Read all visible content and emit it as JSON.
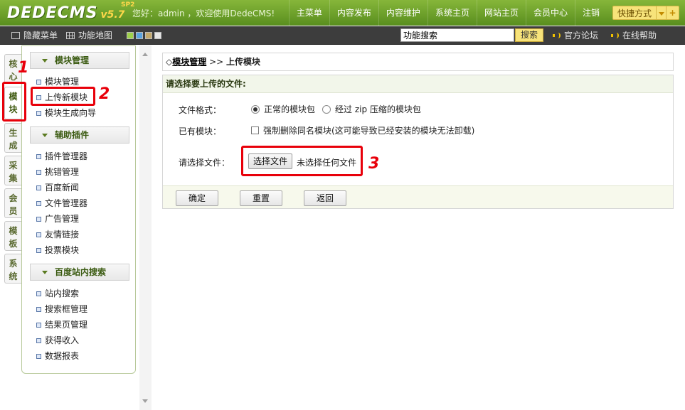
{
  "header": {
    "logo": "DEDECMS",
    "version": "v5.7",
    "edition": "SP2",
    "welcome": "您好：admin ，欢迎使用DedeCMS!",
    "nav": [
      "主菜单",
      "内容发布",
      "内容维护",
      "系统主页",
      "网站主页",
      "会员中心",
      "注销"
    ],
    "quick_label": "快捷方式",
    "quick_plus": "+"
  },
  "subbar": {
    "hide_menu": "隐藏菜单",
    "func_map": "功能地图",
    "swatch_colors": [
      "#9ed14b",
      "#5aa3e0",
      "#c4a86a",
      "#e6e6e6"
    ],
    "search_value": "功能搜索",
    "search_btn": "搜索",
    "forum": "官方论坛",
    "help": "在线帮助"
  },
  "tabs": [
    {
      "label": "核心"
    },
    {
      "label": "模块"
    },
    {
      "label": "生成"
    },
    {
      "label": "采集"
    },
    {
      "label": "会员"
    },
    {
      "label": "模板"
    },
    {
      "label": "系统"
    }
  ],
  "menu": {
    "module_head": "模块管理",
    "module_items": [
      "模块管理",
      "上传新模块",
      "模块生成向导"
    ],
    "plugin_head": "辅助插件",
    "plugin_items": [
      "插件管理器",
      "挑错管理",
      "百度新闻",
      "文件管理器",
      "广告管理",
      "友情链接",
      "投票模块"
    ],
    "baidu_head": "百度站内搜索",
    "baidu_items": [
      "站内搜索",
      "搜索框管理",
      "结果页管理",
      "获得收入",
      "数据报表"
    ]
  },
  "breadcrumb": {
    "prefix": "◇",
    "link": "模块管理",
    "sep": " >> ",
    "current": "上传模块"
  },
  "form": {
    "title": "请选择要上传的文件:",
    "format_label": "文件格式：",
    "format_opt1": "正常的模块包",
    "format_opt2": "经过 zip 压缩的模块包",
    "exist_label": "已有模块：",
    "exist_opt": "强制删除同名模块(这可能导致已经安装的模块无法卸载)",
    "file_label": "请选择文件：",
    "file_btn": "选择文件",
    "file_none": "未选择任何文件",
    "ok": "确定",
    "reset": "重置",
    "back": "返回"
  },
  "annotations": {
    "n1": "1",
    "n2": "2",
    "n3": "3",
    "color": "#e8000a"
  }
}
